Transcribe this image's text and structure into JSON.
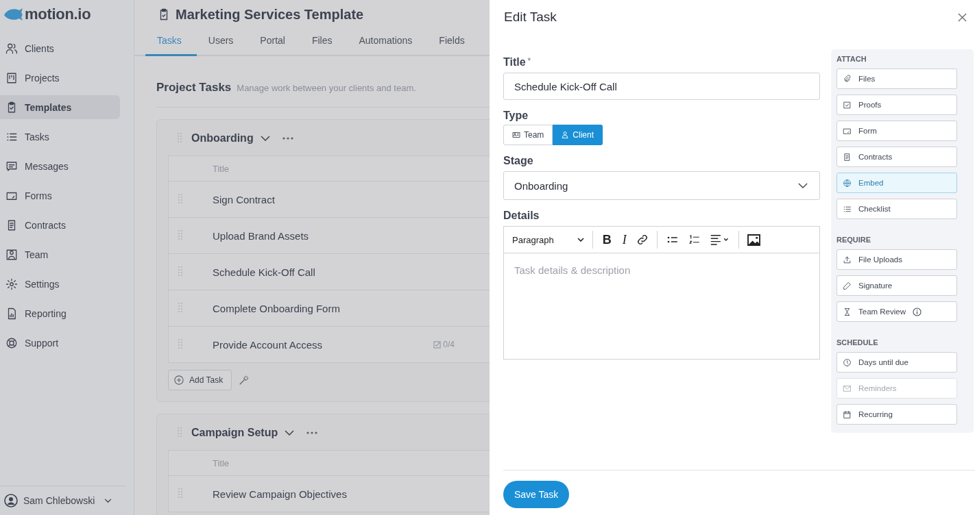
{
  "sidebar": {
    "logo": "motion.io",
    "items": [
      {
        "label": "Clients",
        "selected": false
      },
      {
        "label": "Projects",
        "selected": false
      },
      {
        "label": "Templates",
        "selected": true
      },
      {
        "label": "Tasks",
        "selected": false
      },
      {
        "label": "Messages",
        "selected": false
      },
      {
        "label": "Forms",
        "selected": false
      },
      {
        "label": "Contracts",
        "selected": false
      },
      {
        "label": "Team",
        "selected": false
      },
      {
        "label": "Settings",
        "selected": false
      },
      {
        "label": "Reporting",
        "selected": false
      },
      {
        "label": "Support",
        "selected": false
      }
    ],
    "user": "Sam Chlebowski"
  },
  "page": {
    "title": "Marketing Services Template",
    "tabs": [
      {
        "label": "Tasks",
        "selected": true
      },
      {
        "label": "Users",
        "selected": false
      },
      {
        "label": "Portal",
        "selected": false
      },
      {
        "label": "Files",
        "selected": false
      },
      {
        "label": "Automations",
        "selected": false
      },
      {
        "label": "Fields",
        "selected": false
      }
    ],
    "section_title": "Project Tasks",
    "section_subtitle": "Manage work between your clients and team.",
    "groups": [
      {
        "name": "Onboarding",
        "column": "Title",
        "tasks": [
          {
            "title": "Sign Contract"
          },
          {
            "title": "Upload Brand Assets"
          },
          {
            "title": "Schedule Kick-Off Call"
          },
          {
            "title": "Complete Onboarding Form"
          },
          {
            "title": "Provide Account Access",
            "checklist": "0/4"
          }
        ],
        "add_button": "Add Task"
      },
      {
        "name": "Campaign Setup",
        "column": "Title",
        "tasks": [
          {
            "title": "Review Campaign Objectives"
          }
        ]
      }
    ]
  },
  "drawer": {
    "title": "Edit Task",
    "title_label": "Title",
    "required_mark": "*",
    "title_value": "Schedule Kick-Off Call",
    "type_label": "Type",
    "type_options": [
      {
        "label": "Team",
        "selected": false
      },
      {
        "label": "Client",
        "selected": true
      }
    ],
    "stage_label": "Stage",
    "stage_value": "Onboarding",
    "details_label": "Details",
    "format": "Paragraph",
    "bold_label": "B",
    "italic_label": "I",
    "details_placeholder": "Task details & description",
    "sections": [
      {
        "heading": "ATTACH",
        "items": [
          {
            "label": "Files",
            "hovered": false,
            "disabled": false
          },
          {
            "label": "Proofs",
            "hovered": false,
            "disabled": false
          },
          {
            "label": "Form",
            "hovered": false,
            "disabled": false
          },
          {
            "label": "Contracts",
            "hovered": false,
            "disabled": false
          },
          {
            "label": "Embed",
            "hovered": true,
            "disabled": false
          },
          {
            "label": "Checklist",
            "hovered": false,
            "disabled": false
          }
        ]
      },
      {
        "heading": "REQUIRE",
        "items": [
          {
            "label": "File Uploads",
            "hovered": false,
            "disabled": false
          },
          {
            "label": "Signature",
            "hovered": false,
            "disabled": false
          },
          {
            "label": "Team Review",
            "hovered": false,
            "disabled": false,
            "info": true
          }
        ]
      },
      {
        "heading": "SCHEDULE",
        "items": [
          {
            "label": "Days until due",
            "hovered": false,
            "disabled": false
          },
          {
            "label": "Reminders",
            "hovered": false,
            "disabled": true
          },
          {
            "label": "Recurring",
            "hovered": false,
            "disabled": false
          }
        ]
      }
    ],
    "save_button": "Save Task"
  }
}
